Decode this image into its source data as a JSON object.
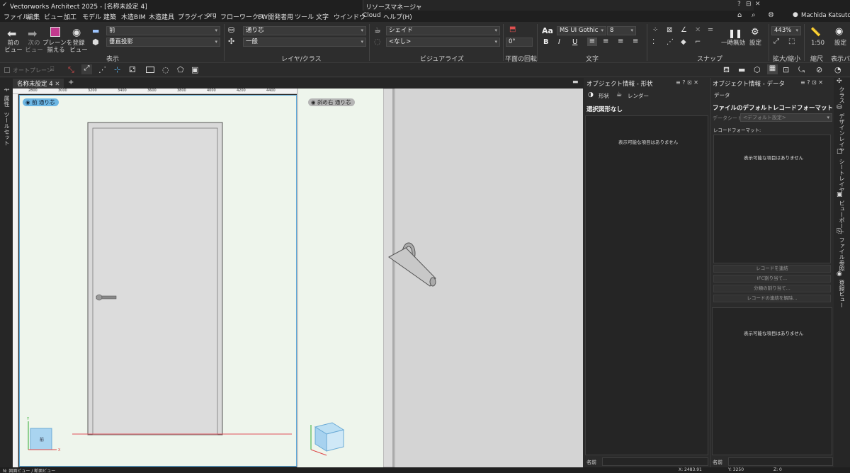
{
  "titlebar": {
    "app_title": "Vectorworks Architect 2025 - [名称未設定 4]",
    "resource_manager": "リソースマネージャ",
    "buttons": [
      "?",
      "⊟",
      "✕"
    ],
    "user": "Machida Katsutoshi"
  },
  "menubar": [
    "ファイル",
    "編集",
    "ビュー",
    "加工",
    "モデル",
    "建築",
    "木造BIM",
    "木造建具",
    "プラグイン",
    "org",
    "フローワークス",
    "FW開発者用",
    "ツール",
    "文字",
    "ウインドウ",
    "Cloud",
    "ヘルプ(H)"
  ],
  "ribbon": {
    "nav": {
      "prev": "前の\nビュー",
      "next": "次の\nビュー",
      "align_plane": "プレーンを\n揃える",
      "register_view": "登録\nビュー"
    },
    "view_select": "前",
    "projection_select": "垂直投影",
    "layer_select": "通り芯",
    "class_select": "一般",
    "render_select": "シェイド",
    "render_sub_select": "<なし>",
    "rotation_value": "0°",
    "font_select": "MS UI Gothic",
    "font_size": "8",
    "zoom_value": "443%",
    "scale_value": "1:50",
    "pause_label": "一時無効",
    "settings_label": "設定",
    "settings_label2": "設定",
    "group_labels": {
      "display": "表示",
      "layer_class": "レイヤ/クラス",
      "visualize": "ビジュアライズ",
      "plane_rotation": "平面の回転",
      "text": "文字",
      "snap": "スナップ",
      "zoom": "拡大/縮小",
      "scale": "縮尺",
      "display_bar": "表示バー"
    }
  },
  "toolbar2": {
    "auto_plane": "オートプレーン"
  },
  "document": {
    "tab": "名称未設定 4",
    "add_tab": "+",
    "left_strip": [
      "基本",
      "属性",
      "ツールセット"
    ],
    "ruler_ticks": [
      "2800",
      "3000",
      "3200",
      "3400",
      "3600",
      "3800",
      "4000",
      "4200",
      "4400"
    ],
    "viewport1_label": "前  通り芯",
    "viewport2_label": "斜め右  通り芯"
  },
  "obj_info_shape": {
    "title": "オブジェクト情報 - 形状",
    "tab_shape": "形状",
    "tab_render": "レンダー",
    "no_selection": "選択図形なし",
    "empty_message": "表示可能な項目はありません",
    "name_label": "名前"
  },
  "obj_info_data": {
    "title": "オブジェクト情報 - データ",
    "tab": "データ",
    "heading": "ファイルのデフォルトレコードフォーマット",
    "datasheet_label": "データシート",
    "datasheet_value": "<デフォルト設定>",
    "record_format_label": "レコードフォーマット:",
    "empty_message": "表示可能な項目はありません",
    "buttons": [
      "レコードを連結",
      "IFC割り当て...",
      "分類の割り当て...",
      "レコードの連結を解除..."
    ],
    "empty_message2": "表示可能な項目はありません",
    "name_label": "名前"
  },
  "right_strip": [
    "クラス",
    "デザインレイヤ",
    "シートレイヤ",
    "ビューポート",
    "ファイル参照",
    "登録ビュー"
  ],
  "statusbar": {
    "left": "N: 図面ビュー / 断面ビュー",
    "x": "X: 2483.91",
    "y": "Y: 3250",
    "z": "Z: 0"
  },
  "colors": {
    "accent": "#5aa6d6",
    "viewport_bg": "#eef5ec",
    "label_blue": "#6cb6e3",
    "gridline_red": "#e0505a"
  }
}
